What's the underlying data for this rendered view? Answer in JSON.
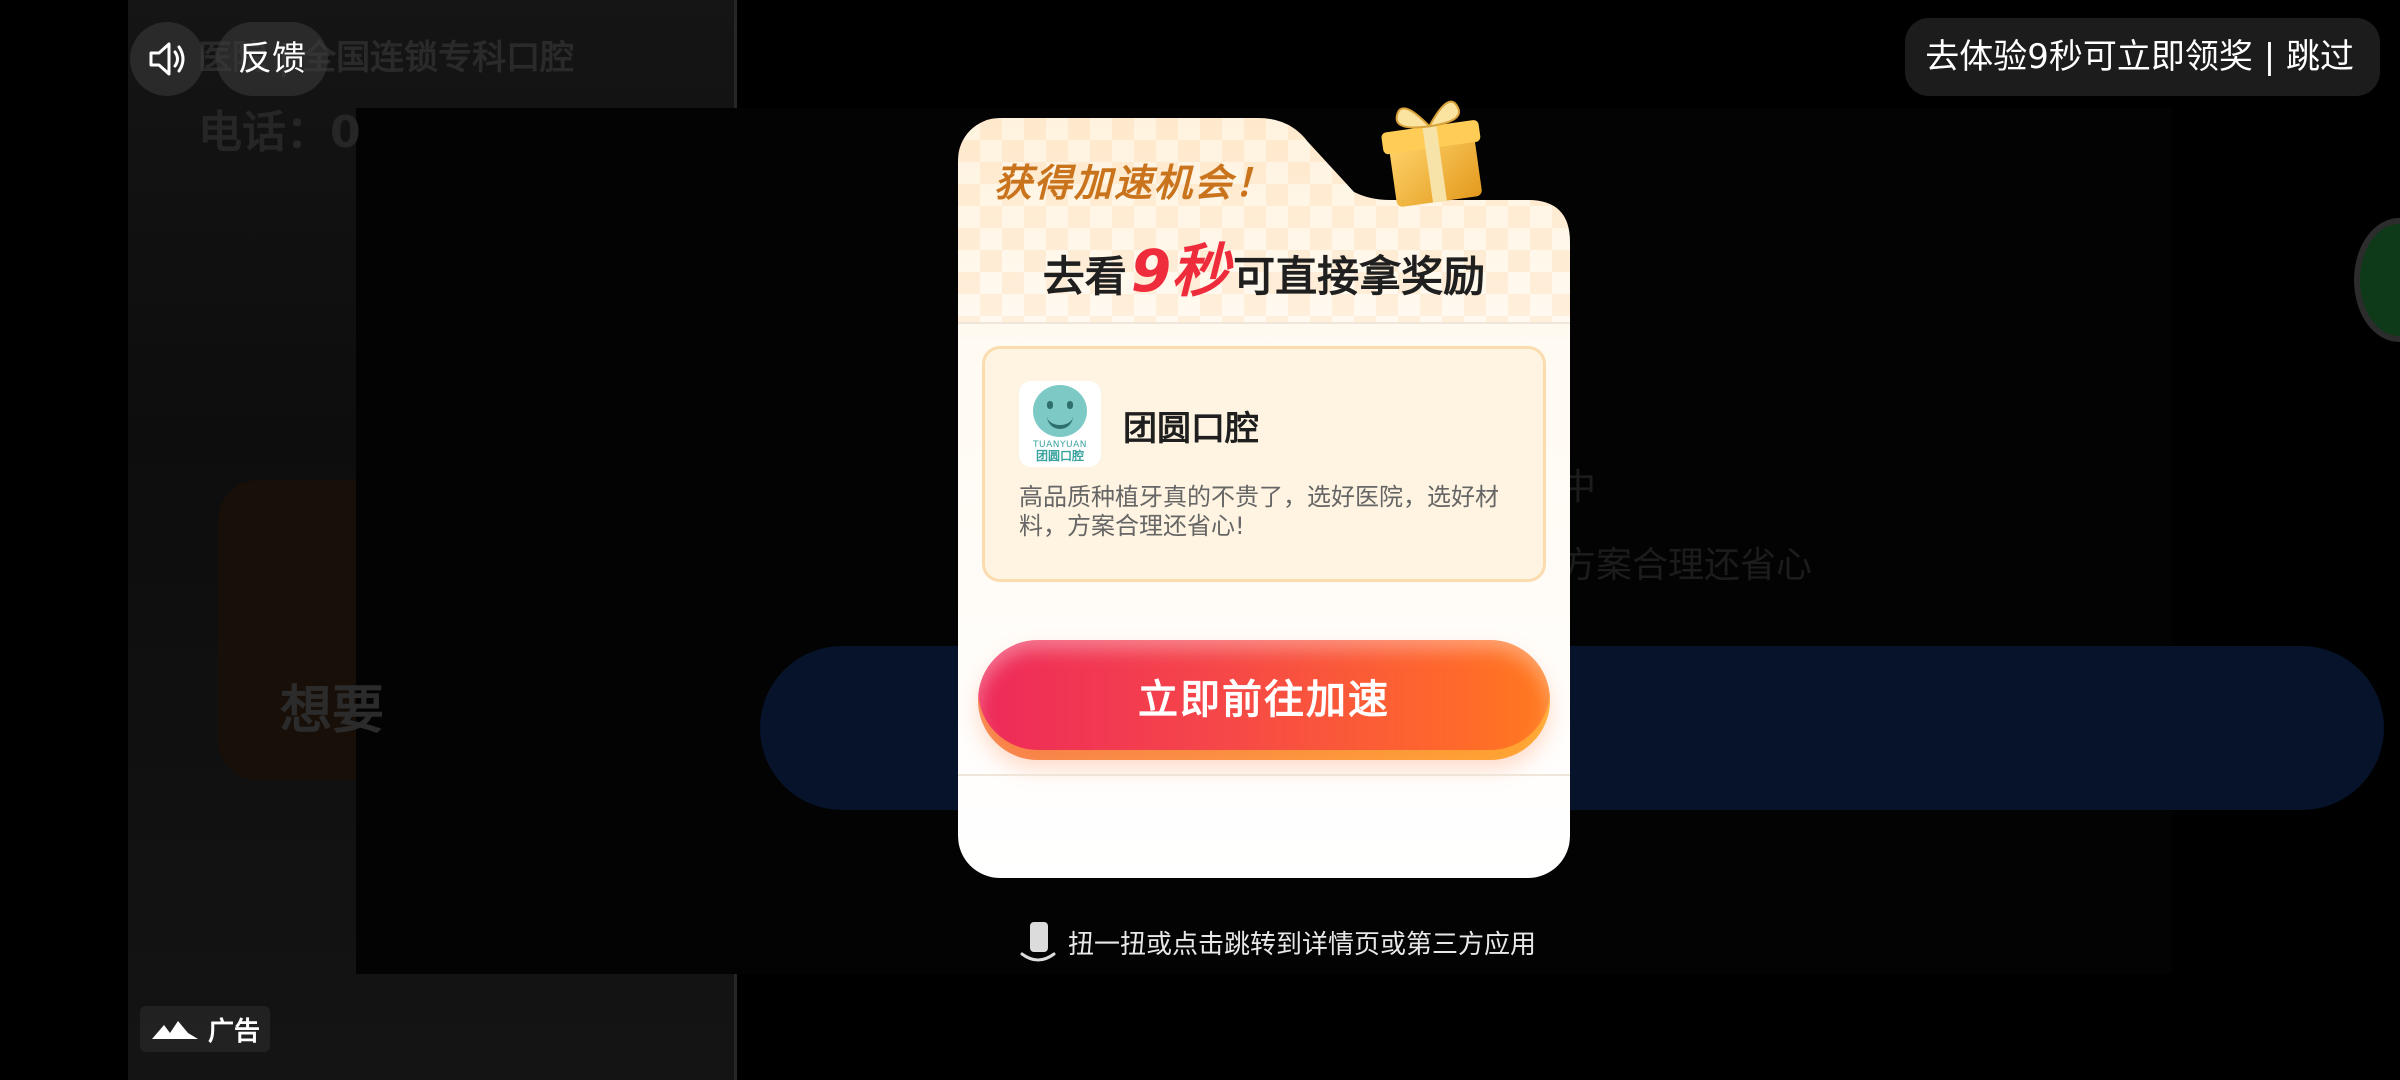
{
  "background": {
    "title": "医院 | 全国连锁专科口腔",
    "phone": "电话：0",
    "slogan": "想要",
    "mid_text_1": "中",
    "mid_text_2": "方案合理还省心"
  },
  "top_bar": {
    "sound_icon": "speaker-icon",
    "feedback_label": "反馈",
    "skip_text": "去体验9秒可立即领奖 | 跳过"
  },
  "modal": {
    "chance_text": "获得加速机会！",
    "headline_prefix": "去看",
    "headline_number": "9秒",
    "headline_suffix": "可直接拿奖励",
    "gift_icon": "gift-box-icon",
    "app": {
      "name": "团圆口腔",
      "icon_text_en": "TUANYUAN",
      "icon_text_cn": "团圆口腔",
      "description": "高品质种植牙真的不贵了，选好医院，选好材料，方案合理还省心!"
    },
    "cta_label": "立即前往加速",
    "accent_colors": {
      "cta_start": "#ee2a5a",
      "cta_end": "#ff7b1f",
      "highlight": "#ee2c3c"
    }
  },
  "hint": {
    "icon": "phone-shake-icon",
    "text": "扭一扭或点击跳转到详情页或第三方应用"
  },
  "ad_badge": {
    "icon": "ad-logo-icon",
    "label": "广告"
  }
}
